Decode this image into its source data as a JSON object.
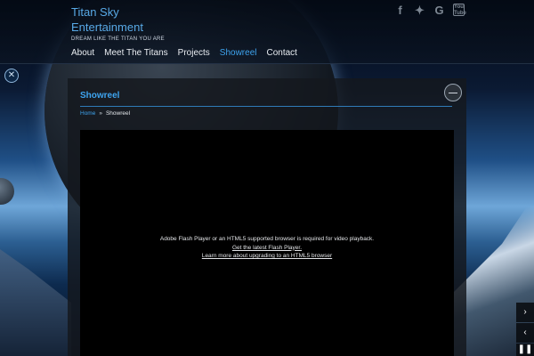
{
  "brand": {
    "title": "Titan Sky Entertainment",
    "tagline": "DREAM LIKE THE TITAN YOU ARE"
  },
  "social": {
    "facebook": "f",
    "twitter": "t",
    "google": "G",
    "youtube": "You Tube"
  },
  "nav": {
    "items": [
      {
        "label": "About"
      },
      {
        "label": "Meet The Titans"
      },
      {
        "label": "Projects"
      },
      {
        "label": "Showreel"
      },
      {
        "label": "Contact"
      }
    ],
    "active": "Showreel"
  },
  "page": {
    "title": "Showreel",
    "breadcrumb": {
      "home": "Home",
      "separator": "»",
      "current": "Showreel"
    }
  },
  "video": {
    "message": "Adobe Flash Player or an HTML5 supported browser is required for video playback.",
    "link_flash": "Get the latest Flash Player.",
    "link_html5": "Learn more about upgrading to an HTML5 browser"
  },
  "colors": {
    "accent": "#3ea4ef",
    "panel": "#14181e"
  },
  "icons": {
    "close": "close-icon",
    "collapse": "minus-circle-icon",
    "next": "chevron-right-icon",
    "prev": "chevron-left-icon",
    "pause": "pause-icon"
  }
}
